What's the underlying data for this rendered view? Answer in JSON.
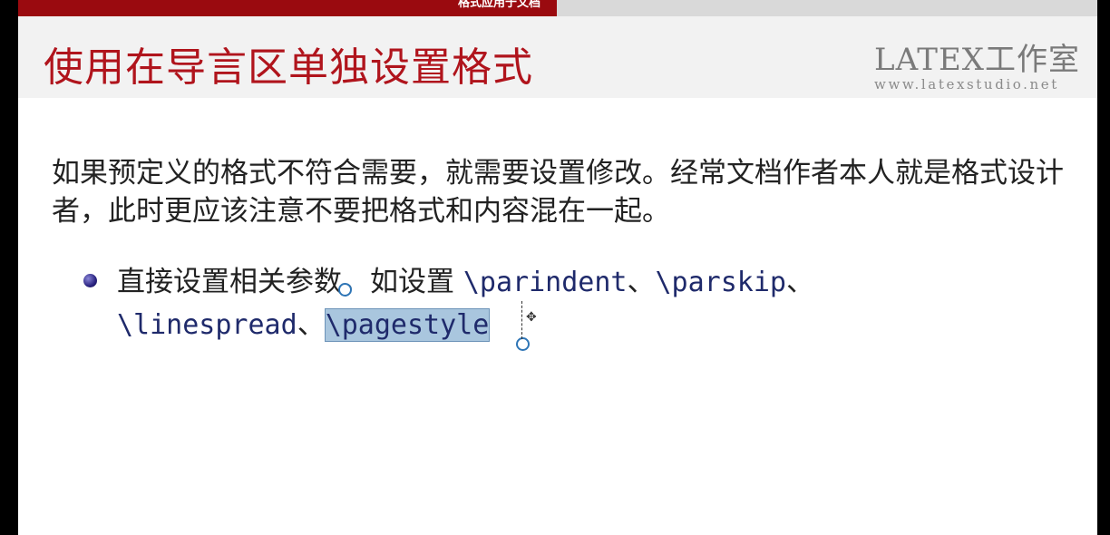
{
  "header": {
    "section_tab": "格式应用于文档",
    "title": "使用在导言区单独设置格式"
  },
  "logo": {
    "mark": "LATEX",
    "cn": "工作室",
    "url": "www.latexstudio.net"
  },
  "body": {
    "intro": "如果预定义的格式不符合需要，就需要设置修改。经常文档作者本人就是格式设计者，此时更应该注意不要把格式和内容混在一起。",
    "bullet": {
      "prefix": "直接设置相关参数。如设置 ",
      "cmd1": "\\parindent",
      "sep1": "、",
      "cmd2": "\\parskip",
      "sep2": "、",
      "cmd3": "\\linespread",
      "sep3": "、",
      "cmd4": "\\pagestyle"
    }
  },
  "colors": {
    "title_red": "#b0141c",
    "tab_red": "#9a0a0f",
    "selection": "#a9c6de",
    "command_blue": "#1f2a6b"
  }
}
